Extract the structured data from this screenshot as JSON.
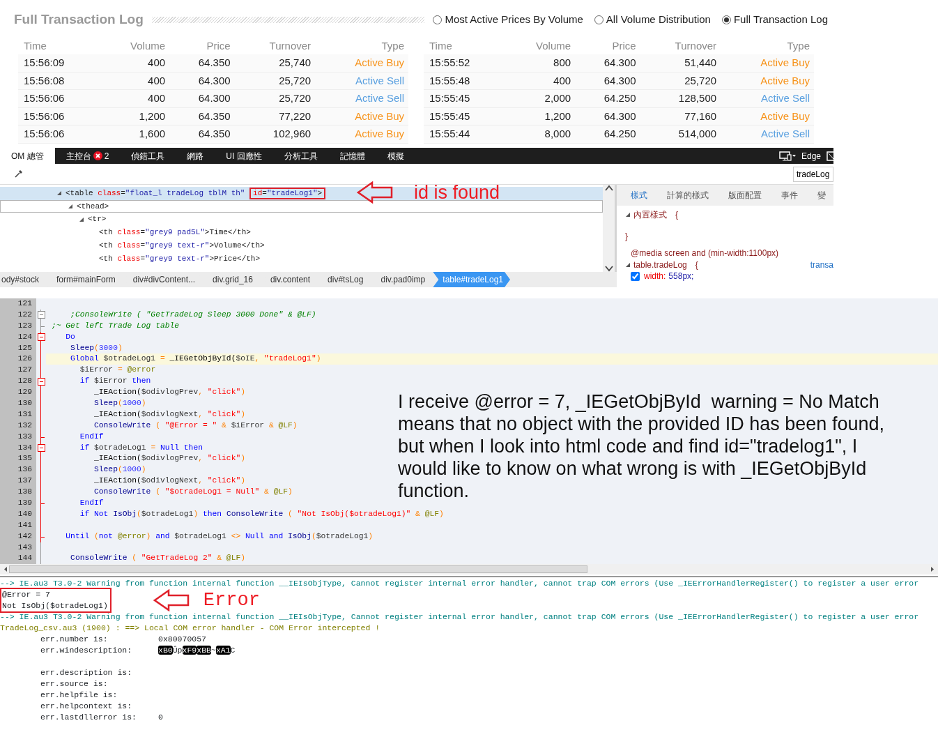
{
  "trade_log": {
    "title": "Full Transaction Log",
    "views": [
      {
        "label": "Most Active Prices By Volume",
        "selected": false
      },
      {
        "label": "All Volume Distribution",
        "selected": false
      },
      {
        "label": "Full Transaction Log",
        "selected": true
      }
    ],
    "tables": [
      {
        "columns": [
          "Time",
          "Volume",
          "Price",
          "Turnover",
          "Type"
        ],
        "rows": [
          {
            "cells": [
              "15:56:09",
              "400",
              "64.350",
              "25,740",
              "Active Buy"
            ],
            "kind": "buy"
          },
          {
            "cells": [
              "15:56:08",
              "400",
              "64.300",
              "25,720",
              "Active Sell"
            ],
            "kind": "sell"
          },
          {
            "cells": [
              "15:56:06",
              "400",
              "64.300",
              "25,720",
              "Active Sell"
            ],
            "kind": "sell"
          },
          {
            "cells": [
              "15:56:06",
              "1,200",
              "64.350",
              "77,220",
              "Active Buy"
            ],
            "kind": "buy"
          },
          {
            "cells": [
              "15:56:06",
              "1,600",
              "64.350",
              "102,960",
              "Active Buy"
            ],
            "kind": "buy"
          }
        ]
      },
      {
        "columns": [
          "Time",
          "Volume",
          "Price",
          "Turnover",
          "Type"
        ],
        "rows": [
          {
            "cells": [
              "15:55:52",
              "800",
              "64.300",
              "51,440",
              "Active Buy"
            ],
            "kind": "buy"
          },
          {
            "cells": [
              "15:55:48",
              "400",
              "64.300",
              "25,720",
              "Active Buy"
            ],
            "kind": "buy"
          },
          {
            "cells": [
              "15:55:45",
              "2,000",
              "64.250",
              "128,500",
              "Active Sell"
            ],
            "kind": "sell"
          },
          {
            "cells": [
              "15:55:45",
              "1,200",
              "64.300",
              "77,160",
              "Active Buy"
            ],
            "kind": "buy"
          },
          {
            "cells": [
              "15:55:44",
              "8,000",
              "64.250",
              "514,000",
              "Active Sell"
            ],
            "kind": "sell"
          }
        ]
      }
    ]
  },
  "devtools": {
    "tabs": [
      {
        "label": "OM 總管",
        "selected": true
      },
      {
        "label": "主控台",
        "selected": false,
        "badge": "2"
      },
      {
        "label": "偵錯工具",
        "selected": false
      },
      {
        "label": "網路",
        "selected": false
      },
      {
        "label": "UI 回應性",
        "selected": false
      },
      {
        "label": "分析工具",
        "selected": false
      },
      {
        "label": "記憶體",
        "selected": false
      },
      {
        "label": "模擬",
        "selected": false
      }
    ],
    "target": "Edge",
    "search": {
      "value": "tradeLog"
    },
    "dom_tree": [
      {
        "expanded": true,
        "selected": true,
        "hovered": false,
        "callout": "id is found",
        "tokens": [
          {
            "kind": "tag",
            "text": "<table "
          },
          {
            "kind": "attr",
            "text": "class"
          },
          {
            "kind": "tag",
            "text": "="
          },
          {
            "kind": "val",
            "text": "\"float_l tradeLog tblM th\" "
          }
        ],
        "highlighted_tokens": [
          {
            "kind": "attr",
            "text": "id"
          },
          {
            "kind": "tag",
            "text": "="
          },
          {
            "kind": "val",
            "text": "\"tradeLog1\""
          },
          {
            "kind": "tag",
            "text": ">"
          }
        ],
        "children": [
          {
            "expanded": true,
            "selected": false,
            "hovered": true,
            "tokens": [
              {
                "kind": "tag",
                "text": "<thead>"
              }
            ],
            "children": [
              {
                "expanded": true,
                "selected": false,
                "hovered": false,
                "tokens": [
                  {
                    "kind": "tag",
                    "text": "<tr>"
                  }
                ],
                "children": [
                  {
                    "selected": false,
                    "hovered": false,
                    "tokens": [
                      {
                        "kind": "tag",
                        "text": "<th "
                      },
                      {
                        "kind": "attr",
                        "text": "class"
                      },
                      {
                        "kind": "tag",
                        "text": "="
                      },
                      {
                        "kind": "val",
                        "text": "\"grey9 pad5L\""
                      },
                      {
                        "kind": "tag",
                        "text": ">Time</th>"
                      }
                    ]
                  },
                  {
                    "selected": false,
                    "hovered": false,
                    "tokens": [
                      {
                        "kind": "tag",
                        "text": "<th "
                      },
                      {
                        "kind": "attr",
                        "text": "class"
                      },
                      {
                        "kind": "tag",
                        "text": "="
                      },
                      {
                        "kind": "val",
                        "text": "\"grey9 text-r\""
                      },
                      {
                        "kind": "tag",
                        "text": ">Volume</th>"
                      }
                    ]
                  },
                  {
                    "selected": false,
                    "hovered": false,
                    "tokens": [
                      {
                        "kind": "tag",
                        "text": "<th "
                      },
                      {
                        "kind": "attr",
                        "text": "class"
                      },
                      {
                        "kind": "tag",
                        "text": "="
                      },
                      {
                        "kind": "val",
                        "text": "\"grey9 text-r\""
                      },
                      {
                        "kind": "tag",
                        "text": ">Price</th>"
                      }
                    ]
                  }
                ]
              }
            ]
          }
        ]
      }
    ],
    "breadcrumb": [
      {
        "label": "ody#stock",
        "selected": false
      },
      {
        "label": "form#mainForm",
        "selected": false
      },
      {
        "label": "div#divContent...",
        "selected": false
      },
      {
        "label": "div.grid_16",
        "selected": false
      },
      {
        "label": "div.content",
        "selected": false
      },
      {
        "label": "div#tsLog",
        "selected": false
      },
      {
        "label": "div.pad0imp",
        "selected": false
      },
      {
        "label": "table#tradeLog1",
        "selected": true
      }
    ],
    "style_tabs": [
      {
        "label": "樣式",
        "selected": true
      },
      {
        "label": "計算的樣式",
        "selected": false
      },
      {
        "label": "版面配置",
        "selected": false
      },
      {
        "label": "事件",
        "selected": false
      },
      {
        "label": "變",
        "selected": false
      }
    ],
    "style_rules": [
      {
        "selector": "內置樣式",
        "open": "{",
        "close": "}"
      },
      {
        "media": "@media screen and (min-width:1100px)",
        "selector": "table.tradeLog",
        "open": "{",
        "source": "transa",
        "declarations": [
          {
            "property": "width:",
            "value": "558px;",
            "checked": true
          }
        ]
      }
    ]
  },
  "editor": {
    "note": "I receive @error = 7, _IEGetObjById  warning = No Match means that no object with the provided ID has been found, but when I look into html code and find id=\"tradelog1\", I would like to know on what wrong is with _IEGetObjById function.",
    "lines": [
      {
        "number": "121"
      },
      {
        "number": "122",
        "fold_open": true,
        "tokens": [
          {
            "kind": "cm",
            "text": "    ;ConsoleWrite ( \"GetTradeLog Sleep 3000 Done\" & @LF)"
          }
        ]
      },
      {
        "number": "123",
        "fold_end": true,
        "tokens": [
          {
            "kind": "cm",
            "text": ";~ Get left Trade Log table"
          }
        ]
      },
      {
        "number": "124",
        "fold_open": true,
        "active": true,
        "tokens": [
          {
            "kind": "kw",
            "text": "   Do"
          }
        ]
      },
      {
        "number": "125",
        "active": true,
        "tokens": [
          {
            "kind": "fn",
            "text": "    Sleep"
          },
          {
            "kind": "op",
            "text": "("
          },
          {
            "kind": "num",
            "text": "3000"
          },
          {
            "kind": "op",
            "text": ")"
          }
        ]
      },
      {
        "number": "126",
        "active": true,
        "current": true,
        "tokens": [
          {
            "kind": "kw",
            "text": "    Global"
          },
          {
            "kind": "var",
            "text": " $otradeLog1 "
          },
          {
            "kind": "op",
            "text": "="
          },
          {
            "kind": "udf",
            "text": " _IEGetObjById("
          },
          {
            "kind": "var",
            "text": "$oIE"
          },
          {
            "kind": "op",
            "text": ", "
          },
          {
            "kind": "str",
            "text": "\"tradeLog1\""
          },
          {
            "kind": "op",
            "text": ")"
          }
        ]
      },
      {
        "number": "127",
        "active": true,
        "tokens": [
          {
            "kind": "var",
            "text": "      $iError "
          },
          {
            "kind": "op",
            "text": "= "
          },
          {
            "kind": "macro",
            "text": "@error"
          }
        ]
      },
      {
        "number": "128",
        "fold_open": true,
        "active": true,
        "tokens": [
          {
            "kind": "kw",
            "text": "      if"
          },
          {
            "kind": "var",
            "text": " $iError "
          },
          {
            "kind": "kw",
            "text": "then"
          }
        ]
      },
      {
        "number": "129",
        "active": true,
        "tokens": [
          {
            "kind": "udf",
            "text": "         _IEAction("
          },
          {
            "kind": "var",
            "text": "$odivlogPrev"
          },
          {
            "kind": "op",
            "text": ", "
          },
          {
            "kind": "str",
            "text": "\"click\""
          },
          {
            "kind": "op",
            "text": ")"
          }
        ]
      },
      {
        "number": "130",
        "active": true,
        "tokens": [
          {
            "kind": "fn",
            "text": "         Sleep"
          },
          {
            "kind": "op",
            "text": "("
          },
          {
            "kind": "num",
            "text": "1000"
          },
          {
            "kind": "op",
            "text": ")"
          }
        ]
      },
      {
        "number": "131",
        "active": true,
        "tokens": [
          {
            "kind": "udf",
            "text": "         _IEAction("
          },
          {
            "kind": "var",
            "text": "$odivlogNext"
          },
          {
            "kind": "op",
            "text": ", "
          },
          {
            "kind": "str",
            "text": "\"click\""
          },
          {
            "kind": "op",
            "text": ")"
          }
        ]
      },
      {
        "number": "132",
        "active": true,
        "tokens": [
          {
            "kind": "fn",
            "text": "         ConsoleWrite"
          },
          {
            "kind": "op",
            "text": " ( "
          },
          {
            "kind": "str",
            "text": "\"@Error = \""
          },
          {
            "kind": "op",
            "text": " & "
          },
          {
            "kind": "var",
            "text": "$iError"
          },
          {
            "kind": "op",
            "text": " & "
          },
          {
            "kind": "macro",
            "text": "@LF"
          },
          {
            "kind": "op",
            "text": ")"
          }
        ]
      },
      {
        "number": "133",
        "fold_end": true,
        "active": true,
        "tokens": [
          {
            "kind": "kw",
            "text": "      EndIf"
          }
        ]
      },
      {
        "number": "134",
        "fold_open": true,
        "active": true,
        "tokens": [
          {
            "kind": "kw",
            "text": "      if"
          },
          {
            "kind": "var",
            "text": " $otradeLog1 "
          },
          {
            "kind": "op",
            "text": "= "
          },
          {
            "kind": "kw",
            "text": "Null then"
          }
        ]
      },
      {
        "number": "135",
        "active": true,
        "tokens": [
          {
            "kind": "udf",
            "text": "         _IEAction("
          },
          {
            "kind": "var",
            "text": "$odivlogPrev"
          },
          {
            "kind": "op",
            "text": ", "
          },
          {
            "kind": "str",
            "text": "\"click\""
          },
          {
            "kind": "op",
            "text": ")"
          }
        ]
      },
      {
        "number": "136",
        "active": true,
        "tokens": [
          {
            "kind": "fn",
            "text": "         Sleep"
          },
          {
            "kind": "op",
            "text": "("
          },
          {
            "kind": "num",
            "text": "1000"
          },
          {
            "kind": "op",
            "text": ")"
          }
        ]
      },
      {
        "number": "137",
        "active": true,
        "tokens": [
          {
            "kind": "udf",
            "text": "         _IEAction("
          },
          {
            "kind": "var",
            "text": "$odivlogNext"
          },
          {
            "kind": "op",
            "text": ", "
          },
          {
            "kind": "str",
            "text": "\"click\""
          },
          {
            "kind": "op",
            "text": ")"
          }
        ]
      },
      {
        "number": "138",
        "active": true,
        "tokens": [
          {
            "kind": "fn",
            "text": "         ConsoleWrite"
          },
          {
            "kind": "op",
            "text": " ( "
          },
          {
            "kind": "str",
            "text": "\"$otradeLog1 = Null\""
          },
          {
            "kind": "op",
            "text": " & "
          },
          {
            "kind": "macro",
            "text": "@LF"
          },
          {
            "kind": "op",
            "text": ")"
          }
        ]
      },
      {
        "number": "139",
        "fold_end": true,
        "active": true,
        "tokens": [
          {
            "kind": "kw",
            "text": "      EndIf"
          }
        ]
      },
      {
        "number": "140",
        "active": true,
        "tokens": [
          {
            "kind": "kw",
            "text": "      if Not "
          },
          {
            "kind": "fn",
            "text": "IsObj"
          },
          {
            "kind": "op",
            "text": "("
          },
          {
            "kind": "var",
            "text": "$otradeLog1"
          },
          {
            "kind": "op",
            "text": ")"
          },
          {
            "kind": "kw",
            "text": " then "
          },
          {
            "kind": "fn",
            "text": "ConsoleWrite"
          },
          {
            "kind": "op",
            "text": " ( "
          },
          {
            "kind": "str",
            "text": "\"Not IsObj($otradeLog1)\""
          },
          {
            "kind": "op",
            "text": " & "
          },
          {
            "kind": "macro",
            "text": "@LF"
          },
          {
            "kind": "op",
            "text": ")"
          }
        ]
      },
      {
        "number": "141",
        "active": true
      },
      {
        "number": "142",
        "fold_end": true,
        "active": true,
        "tokens": [
          {
            "kind": "kw",
            "text": "   Until "
          },
          {
            "kind": "op",
            "text": "("
          },
          {
            "kind": "kw",
            "text": "not "
          },
          {
            "kind": "macro",
            "text": "@error"
          },
          {
            "kind": "op",
            "text": ") "
          },
          {
            "kind": "kw",
            "text": "and"
          },
          {
            "kind": "var",
            "text": " $otradeLog1 "
          },
          {
            "kind": "op",
            "text": "<> "
          },
          {
            "kind": "kw",
            "text": "Null and "
          },
          {
            "kind": "fn",
            "text": "IsObj"
          },
          {
            "kind": "op",
            "text": "("
          },
          {
            "kind": "var",
            "text": "$otradeLog1"
          },
          {
            "kind": "op",
            "text": ")"
          }
        ]
      },
      {
        "number": "143"
      },
      {
        "number": "144",
        "tokens": [
          {
            "kind": "fn",
            "text": "    ConsoleWrite"
          },
          {
            "kind": "op",
            "text": " ( "
          },
          {
            "kind": "str",
            "text": "\"GetTradeLog 2\""
          },
          {
            "kind": "op",
            "text": " & "
          },
          {
            "kind": "macro",
            "text": "@LF"
          },
          {
            "kind": "op",
            "text": ")"
          }
        ]
      }
    ]
  },
  "console": [
    {
      "kind": "warn",
      "text": "--> IE.au3 T3.0-2 Warning from function internal function __IEIsObjType, Cannot register internal error handler, cannot trap COM errors (Use _IEErrorHandlerRegister() to register a user error"
    },
    {
      "kind": "callout",
      "lines": [
        "@Error = 7",
        "Not IsObj($otradeLog1)"
      ],
      "note": "Error"
    },
    {
      "kind": "warn",
      "text": "--> IE.au3 T3.0-2 Warning from function internal function __IEIsObjType, Cannot register internal error handler, cannot trap COM errors (Use _IEErrorHandlerRegister() to register a user error"
    },
    {
      "kind": "com",
      "text": "TradeLog_csv.au3 (1900) : ==> Local COM error handler - COM Error intercepted !"
    },
    {
      "kind": "field",
      "label": "err.number is:",
      "value": "0x80070057"
    },
    {
      "kind": "field",
      "label": "err.windescription:",
      "segments": [
        {
          "text": "xB0",
          "inverse": true
        },
        {
          "text": "Ûp",
          "inverse": false
        },
        {
          "text": "xF9",
          "inverse": true
        },
        {
          "text": "xBB",
          "inverse": true
        },
        {
          "text": "~",
          "inverse": false
        },
        {
          "text": "xA1",
          "inverse": true
        },
        {
          "text": "C",
          "inverse": false
        }
      ]
    },
    {
      "kind": "blank"
    },
    {
      "kind": "field",
      "label": "err.description is:"
    },
    {
      "kind": "field",
      "label": "err.source is:"
    },
    {
      "kind": "field",
      "label": "err.helpfile is:"
    },
    {
      "kind": "field",
      "label": "err.helpcontext is:"
    },
    {
      "kind": "field",
      "label": "err.lastdllerror is:",
      "value": "0"
    }
  ]
}
